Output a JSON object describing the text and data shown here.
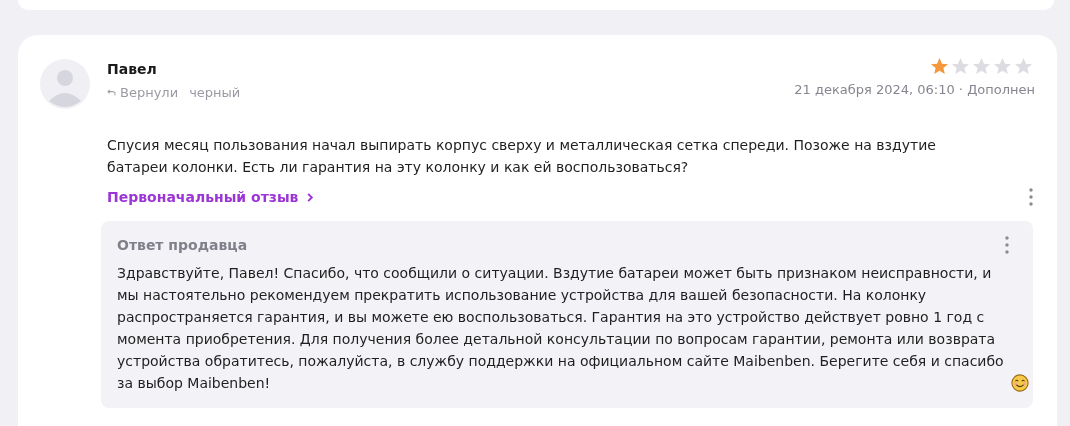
{
  "review": {
    "author": "Павел",
    "return_label": "Вернули",
    "variant": "черный",
    "stars": 1,
    "date": "21 декабря 2024, 06:10 · Дополнен",
    "text": "Спусия месяц пользования начал выпирать корпус сверху и металлическая сетка спереди. Позоже на вздутие батареи колонки. Есть ли гарантия на эту колонку и как ей воспользоваться?",
    "original_link": "Первоначальный отзыв"
  },
  "seller_reply": {
    "title": "Ответ продавца",
    "text": "Здравствуйте, Павел! Спасибо, что сообщили о ситуации. Вздутие батареи может быть признаком неисправности, и мы настоятельно рекомендуем прекратить использование устройства для вашей безопасности. На колонку распространяется гарантия, и вы можете ею воспользоваться. Гарантия на это устройство действует ровно 1 год с момента приобретения. Для получения более детальной консультации по вопросам гарантии, ремонта или возврата устройства обратитесь, пожалуйста, в службу поддержки на официальном сайте Maibenben. Берегите себя и спасибо за выбор Maibenben!"
  }
}
